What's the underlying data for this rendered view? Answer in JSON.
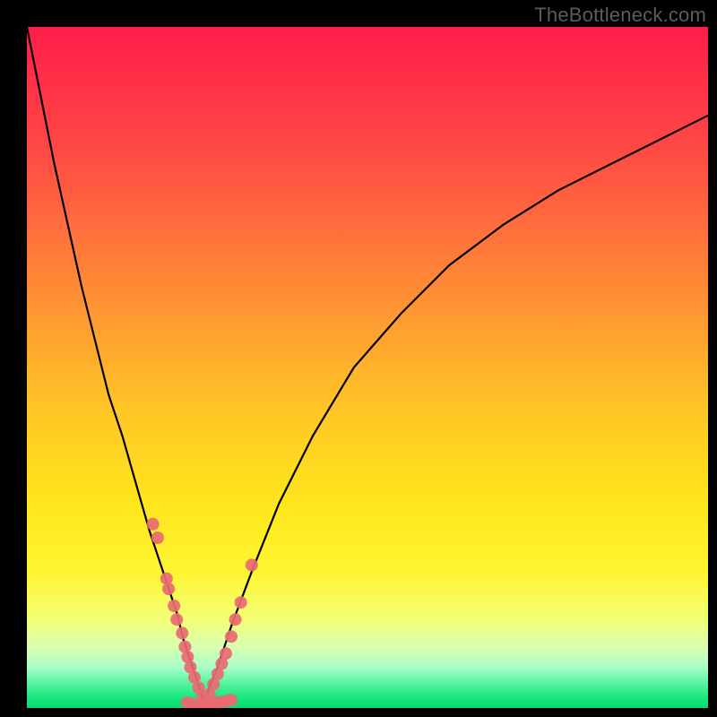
{
  "watermark": "TheBottleneck.com",
  "chart_data": {
    "type": "line",
    "title": "",
    "xlabel": "",
    "ylabel": "",
    "xlim": [
      0,
      100
    ],
    "ylim": [
      0,
      100
    ],
    "grid": false,
    "legend": false,
    "background_gradient_stops": [
      {
        "offset": 0.0,
        "color": "#ff1d4a"
      },
      {
        "offset": 0.18,
        "color": "#ff4945"
      },
      {
        "offset": 0.38,
        "color": "#ff8a36"
      },
      {
        "offset": 0.55,
        "color": "#ffc227"
      },
      {
        "offset": 0.7,
        "color": "#ffe61c"
      },
      {
        "offset": 0.8,
        "color": "#fff531"
      },
      {
        "offset": 0.87,
        "color": "#f3ff76"
      },
      {
        "offset": 0.91,
        "color": "#d8ffb0"
      },
      {
        "offset": 0.94,
        "color": "#aaffc8"
      },
      {
        "offset": 0.96,
        "color": "#63f5a7"
      },
      {
        "offset": 0.985,
        "color": "#18e780"
      },
      {
        "offset": 1.0,
        "color": "#0bd96f"
      }
    ],
    "series": [
      {
        "name": "left-curve",
        "type": "line",
        "x": [
          0,
          2,
          4,
          6,
          8,
          10,
          12,
          14,
          16,
          18,
          20,
          22,
          23,
          24,
          25,
          26
        ],
        "y": [
          100,
          90,
          80,
          71,
          62,
          54,
          46,
          40,
          33,
          26,
          20,
          14,
          10,
          7,
          4,
          1
        ]
      },
      {
        "name": "right-curve",
        "type": "line",
        "x": [
          26,
          28,
          30,
          33,
          37,
          42,
          48,
          55,
          62,
          70,
          78,
          86,
          94,
          100
        ],
        "y": [
          1,
          6,
          12,
          20,
          30,
          40,
          50,
          58,
          65,
          71,
          76,
          80,
          84,
          87
        ]
      },
      {
        "name": "points-left",
        "type": "scatter",
        "color": "#e96a73",
        "x": [
          18.5,
          19.2,
          20.5,
          20.8,
          21.6,
          22.0,
          22.8,
          23.2,
          23.6,
          24.0,
          24.6,
          25.2,
          25.8
        ],
        "y": [
          27.0,
          25.0,
          19.0,
          17.5,
          15.0,
          13.0,
          11.0,
          9.0,
          7.5,
          6.0,
          4.5,
          3.0,
          1.8
        ]
      },
      {
        "name": "points-right",
        "type": "scatter",
        "color": "#e96a73",
        "x": [
          26.8,
          27.4,
          28.0,
          28.6,
          29.2,
          30.0,
          30.6,
          31.4,
          33.0
        ],
        "y": [
          2.0,
          3.5,
          5.0,
          6.5,
          8.0,
          10.5,
          13.0,
          15.5,
          21.0
        ]
      },
      {
        "name": "points-bottom",
        "type": "scatter",
        "color": "#e96a73",
        "x": [
          23.5,
          24.2,
          25.0,
          25.6,
          26.0,
          26.6,
          27.2,
          28.0,
          28.6,
          29.3,
          30.0
        ],
        "y": [
          0.8,
          0.6,
          0.5,
          0.5,
          0.6,
          0.6,
          0.7,
          0.8,
          0.9,
          1.0,
          1.2
        ]
      }
    ]
  }
}
